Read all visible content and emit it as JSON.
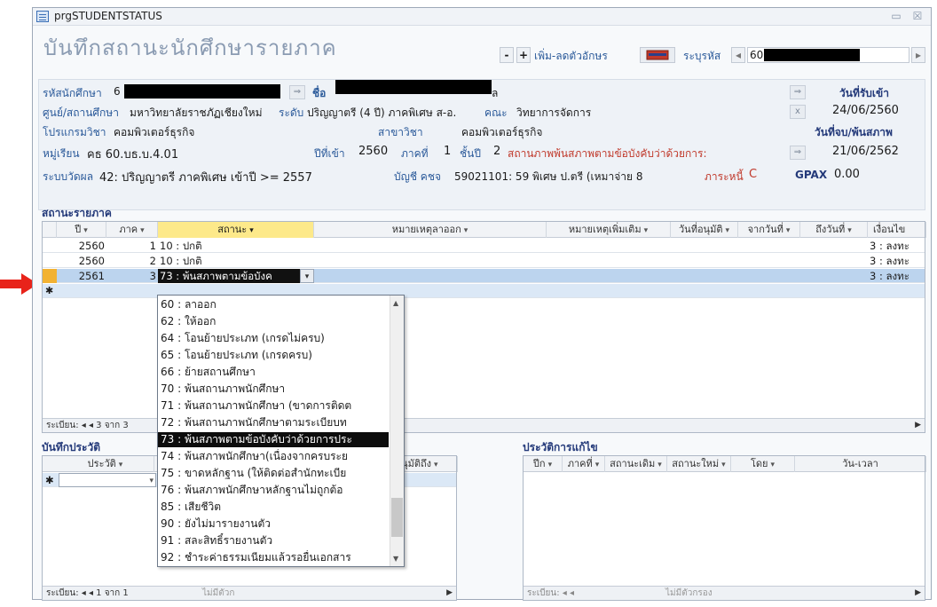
{
  "window": {
    "title": "prgSTUDENTSTATUS",
    "form_title": "บันทึกสถานะนักศึกษารายภาค",
    "minimize": "▭",
    "close": "☒"
  },
  "toolbar": {
    "minus": "-",
    "plus": "+",
    "font_label": "เพิ่ม-ลดตัวอักษร",
    "id_label": "ระบุรหัส",
    "id_value": "60",
    "prev": "◂",
    "next": "▸"
  },
  "info": {
    "student_id_label": "รหัสนักศึกษา",
    "student_id_value": "6",
    "name_label": "ชื่อ",
    "name_tail": "ล",
    "entry_date_label": "วันที่รับเข้า",
    "entry_date_value": "24/06/2560",
    "center_label": "ศูนย์/สถานศึกษา",
    "center_value": "มหาวิทยาลัยราชภัฏเชียงใหม่",
    "level_label": "ระดับ",
    "level_value": "ปริญญาตรี (4 ปี) ภาคพิเศษ ส-อ.",
    "faculty_label": "คณะ",
    "faculty_value": "วิทยาการจัดการ",
    "program_label": "โปรแกรมวิชา",
    "program_value": "คอมพิวเตอร์ธุรกิจ",
    "major_label": "สาขาวิชา",
    "major_value": "คอมพิวเตอร์ธุรกิจ",
    "grad_label": "วันที่จบ/พ้นสภาพ",
    "group_label": "หมู่เรียน",
    "group_value": "คธ 60.บธ.บ.4.01",
    "year_in_label": "ปีที่เข้า",
    "year_in_value": "2560",
    "term_label": "ภาคที่",
    "term_value": "1",
    "class_label": "ชั้นปี",
    "class_value": "2",
    "status_label": "สถานภาพ",
    "status_value": "พ้นสภาพตามข้อบังคับว่าด้วยการ:",
    "grad_date_value": "21/06/2562",
    "eval_label": "ระบบวัดผล",
    "eval_value": "42: ปริญญาตรี ภาคพิเศษ เข้าปี >= 2557",
    "account_label": "บัญชี คชจ",
    "account_value": "59021101: 59 พิเศษ ป.ตรี (เหมาจ่าย 8",
    "debt_label": "ภาระหนี้",
    "debt_value": "C",
    "gpax_label": "GPAX",
    "gpax_value": "0.00"
  },
  "term_status": {
    "section_title": "สถานะรายภาค",
    "columns": [
      "ปี",
      "ภาค",
      "สถานะ",
      "หมายเหตุลาออก",
      "หมายเหตุเพิ่มเติม",
      "วันที่อนุมัติ",
      "จากวันที่",
      "ถึงวันที่",
      "เงื่อนไข"
    ],
    "rows": [
      {
        "year": "2560",
        "term": "1",
        "status": "10 : ปกติ",
        "cond": "3 : ลงทะ"
      },
      {
        "year": "2560",
        "term": "2",
        "status": "10 : ปกติ",
        "cond": "3 : ลงทะ"
      },
      {
        "year": "2561",
        "term": "3",
        "status": "73 : พ้นสภาพตามข้อบังค",
        "cond": "3 : ลงทะ"
      }
    ],
    "new_row_marker": "✱",
    "nav_text": "ระเบียน: ◂ ◂ 3 จาก 3"
  },
  "status_dropdown": {
    "items": [
      "60 : ลาออก",
      "62 : ให้ออก",
      "64 : โอนย้ายประเภท (เกรดไม่ครบ)",
      "65 : โอนย้ายประเภท (เกรดครบ)",
      "66 : ย้ายสถานศึกษา",
      "70 : พ้นสถานภาพนักศึกษา",
      "71 : พ้นสถานภาพนักศึกษา (ขาดการติดต",
      "72 : พ้นสถานภาพนักศึกษาตามระเบียบท",
      "73 : พ้นสภาพตามข้อบังคับว่าด้วยการประ",
      "74 : พ้นสภาพนักศึกษา(เนื่องจากครบระย",
      "75 : ขาดหลักฐาน (ให้ติดต่อสำนักทะเบีย",
      "76 : พ้นสภาพนักศึกษาหลักฐานไม่ถูกต้อ",
      "85 : เสียชีวิต",
      "90 : ยังไม่มารายงานตัว",
      "91 : สละสิทธิ์รายงานตัว",
      "92 : ชำระค่าธรรมเนียมแล้วรอยื่นเอกสาร"
    ],
    "selected_index": 8
  },
  "history": {
    "section_title": "บันทึกประวัติ",
    "columns": [
      "ประวัติ",
      "อนุมัติถึง"
    ],
    "new_row_marker": "✱",
    "nav_text": "ระเบียน: ◂ ◂ 1 จาก 1",
    "filter_text": "ไม่มีตัวก"
  },
  "edit_history": {
    "section_title": "ประวัติการแก้ไข",
    "columns": [
      "ปีก",
      "ภาคที่",
      "สถานะเดิม",
      "สถานะใหม่",
      "โดย",
      "วัน-เวลา"
    ],
    "nav_text": "ระเบียน: ◂ ◂",
    "filter_text": "ไม่มีตัวกรอง"
  },
  "colors": {
    "accent_blue": "#2b5a9a",
    "navy": "#243a7a",
    "red": "#c0392b",
    "selected_row": "#bcd4ee",
    "pointer_arrow": "#e8231a"
  }
}
